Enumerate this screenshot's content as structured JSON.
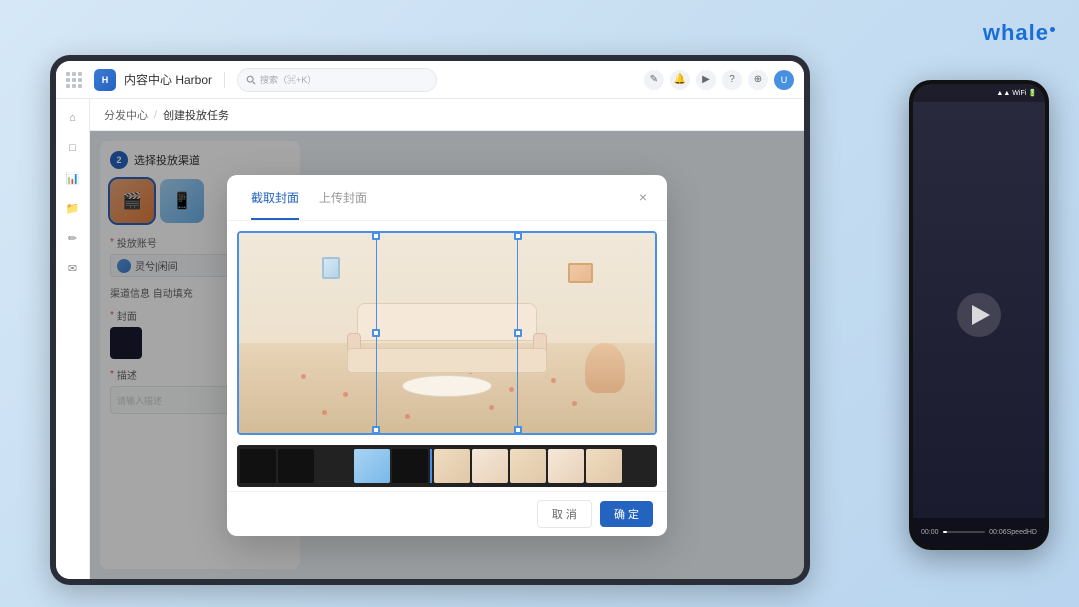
{
  "app": {
    "logo_text": "whale",
    "top_bar": {
      "app_name": "内容中心 Harbor",
      "search_placeholder": "搜索（⌘+K）",
      "grid_icon": "grid",
      "search_icon": "search"
    },
    "breadcrumb": {
      "parent": "分发中心",
      "separator": "/",
      "current": "创建投放任务"
    },
    "step": {
      "number": "2",
      "label": "选择投放渠道"
    }
  },
  "modal": {
    "tab1_label": "截取封面",
    "tab2_label": "上传封面",
    "close_icon": "×",
    "cancel_label": "取 消",
    "confirm_label": "确 定"
  },
  "left_panel": {
    "playback_label": "* 投放账号",
    "account_name": "灵兮|闲间",
    "channel_info_label": "渠道信息 自动填充",
    "cover_label": "* 封面",
    "desc_label": "* 描述",
    "desc_placeholder": "请输入描述"
  },
  "phone": {
    "time": "00:00",
    "duration": "00:06",
    "speed_label": "Speed",
    "resolution_icon": "HD"
  }
}
